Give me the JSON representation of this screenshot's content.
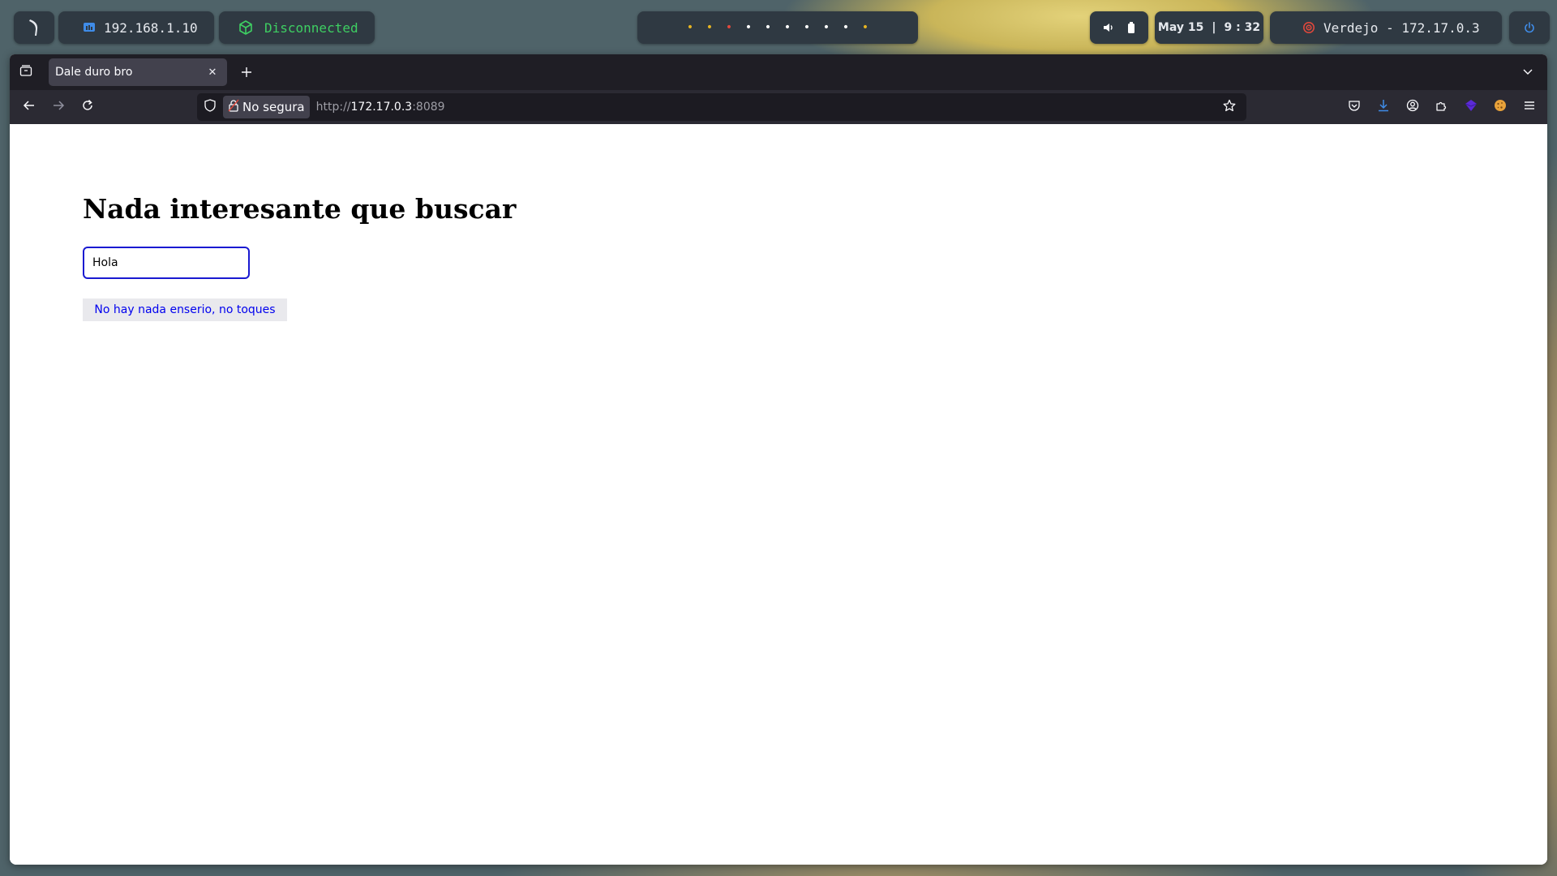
{
  "panel": {
    "ip": "192.168.1.10",
    "vpn_status": "Disconnected",
    "workspace_dots": [
      {
        "color": "#e6b422"
      },
      {
        "color": "#e6b422"
      },
      {
        "color": "#e0483c"
      },
      {
        "color": "#ffffff"
      },
      {
        "color": "#ffffff"
      },
      {
        "color": "#ffffff"
      },
      {
        "color": "#ffffff"
      },
      {
        "color": "#ffffff"
      },
      {
        "color": "#ffffff"
      },
      {
        "color": "#e6b422"
      }
    ],
    "date": "May 15",
    "time": "9 : 32",
    "target": "Verdejo - 172.17.0.3",
    "vpn_color": "#3ecf62",
    "target_icon_color": "#e0483c",
    "accent": "#3f8ce8"
  },
  "browser": {
    "tab_title": "Dale duro bro",
    "security_label": "No segura",
    "url_prefix": "http://",
    "url_host": "172.17.0.3",
    "url_suffix": ":8089"
  },
  "page": {
    "heading": "Nada interesante que buscar",
    "input_value": "Hola",
    "button_label": "No hay nada enserio, no toques",
    "input_border_color": "#1a1ad1",
    "button_text_color": "#0000ee"
  },
  "icons": {
    "panel": [
      "app-logo-icon",
      "network-icon",
      "vpn-cube-icon",
      "volume-icon",
      "battery-icon",
      "target-icon",
      "power-icon"
    ],
    "browser": [
      "tab-manager-icon",
      "close-icon",
      "plus-icon",
      "chevron-down-icon",
      "back-arrow-icon",
      "forward-arrow-icon",
      "reload-icon",
      "shield-icon",
      "lock-icon",
      "star-icon",
      "pocket-icon",
      "download-icon",
      "account-icon",
      "extensions-icon",
      "wappalyzer-icon",
      "cookie-icon",
      "menu-icon"
    ]
  }
}
